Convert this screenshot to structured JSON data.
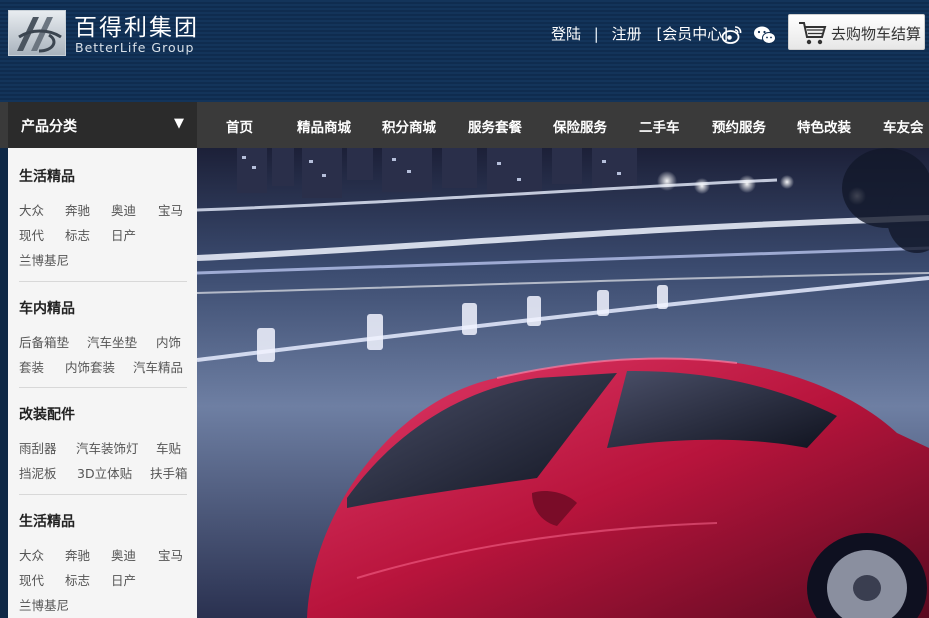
{
  "brand": {
    "name_cn": "百得利集团",
    "name_en": "BetterLife Group"
  },
  "top_links": {
    "login": "登陆",
    "separator": "|",
    "register": "注册",
    "member_center": "[会员中心]"
  },
  "social_icons": [
    "weibo-icon",
    "wechat-icon"
  ],
  "cart": {
    "label": "去购物车结算",
    "icon": "shopping-cart-icon"
  },
  "nav": {
    "category_label": "产品分类",
    "category_arrow": "▼",
    "items": [
      "首页",
      "精品商城",
      "积分商城",
      "服务套餐",
      "保险服务",
      "二手车",
      "预约服务",
      "特色改装",
      "车友会"
    ]
  },
  "sidebar": {
    "groups": [
      {
        "title": "生活精品",
        "rows": [
          [
            "大众",
            "奔驰",
            "奥迪",
            "宝马"
          ],
          [
            "现代",
            "标志",
            "日产"
          ],
          [
            "兰博基尼"
          ]
        ]
      },
      {
        "title": "车内精品",
        "rows": [
          [
            "后备箱垫",
            "汽车坐垫",
            "内饰"
          ],
          [
            "套装",
            "内饰套装",
            "汽车精品"
          ]
        ]
      },
      {
        "title": "改装配件",
        "rows": [
          [
            "雨刮器",
            "汽车装饰灯",
            "车贴"
          ],
          [
            "挡泥板",
            "3D立体贴",
            "扶手箱"
          ]
        ]
      },
      {
        "title": "生活精品",
        "rows": [
          [
            "大众",
            "奔驰",
            "奥迪",
            "宝马"
          ],
          [
            "现代",
            "标志",
            "日产"
          ],
          [
            "兰博基尼"
          ]
        ]
      }
    ]
  },
  "colors": {
    "header_bg": "#0f2c4f",
    "nav_bg": "#3a3a3a",
    "category_bg": "#2b2b2b",
    "sidebar_bg": "#f5f5f5",
    "car_red": "#b8143c"
  }
}
